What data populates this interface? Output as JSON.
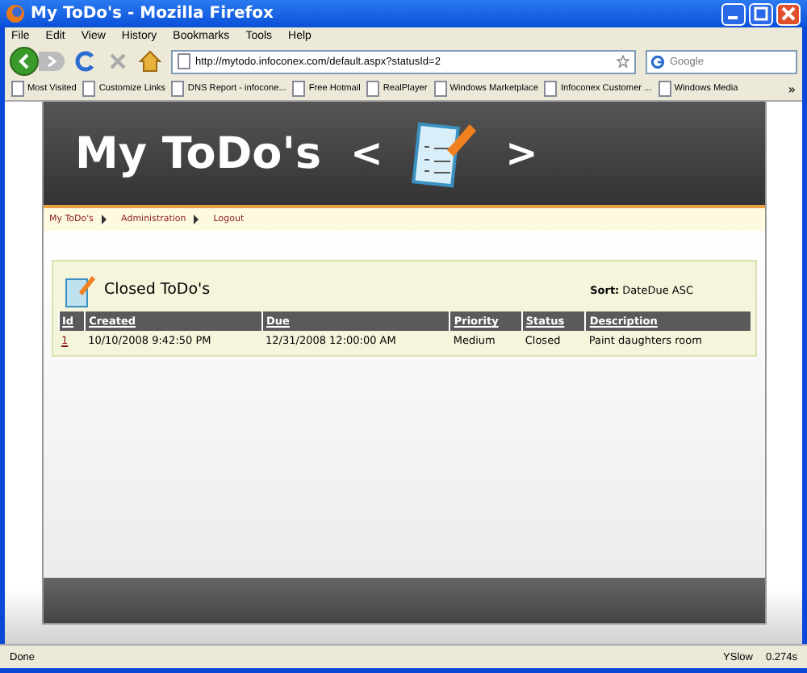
{
  "window": {
    "title": "My ToDo's - Mozilla Firefox"
  },
  "menu": [
    "File",
    "Edit",
    "View",
    "History",
    "Bookmarks",
    "Tools",
    "Help"
  ],
  "address": {
    "value": "http://mytodo.infoconex.com/default.aspx?statusId=2"
  },
  "search": {
    "placeholder": "Google"
  },
  "bookmarks": [
    "Most Visited",
    "Customize Links",
    "DNS Report - infocone...",
    "Free Hotmail",
    "RealPlayer",
    "Windows Marketplace",
    "Infoconex Customer ...",
    "Windows Media"
  ],
  "bookmarks_more": "»",
  "header": {
    "title": "My ToDo's",
    "prev": "<",
    "next": ">"
  },
  "nav": [
    "My ToDo's",
    "Administration",
    "Logout"
  ],
  "panel": {
    "title": "Closed ToDo's",
    "sort_label": "Sort:",
    "sort_value": "DateDue ASC"
  },
  "table": {
    "columns": [
      "Id",
      "Created",
      "Due",
      "Priority",
      "Status",
      "Description"
    ],
    "rows": [
      [
        "1",
        "10/10/2008 9:42:50 PM",
        "12/31/2008 12:00:00 AM",
        "Medium",
        "Closed",
        "Paint daughters room"
      ]
    ]
  },
  "status_bar": {
    "text": "Done",
    "yslow": "YSlow",
    "time": "0.274s"
  }
}
